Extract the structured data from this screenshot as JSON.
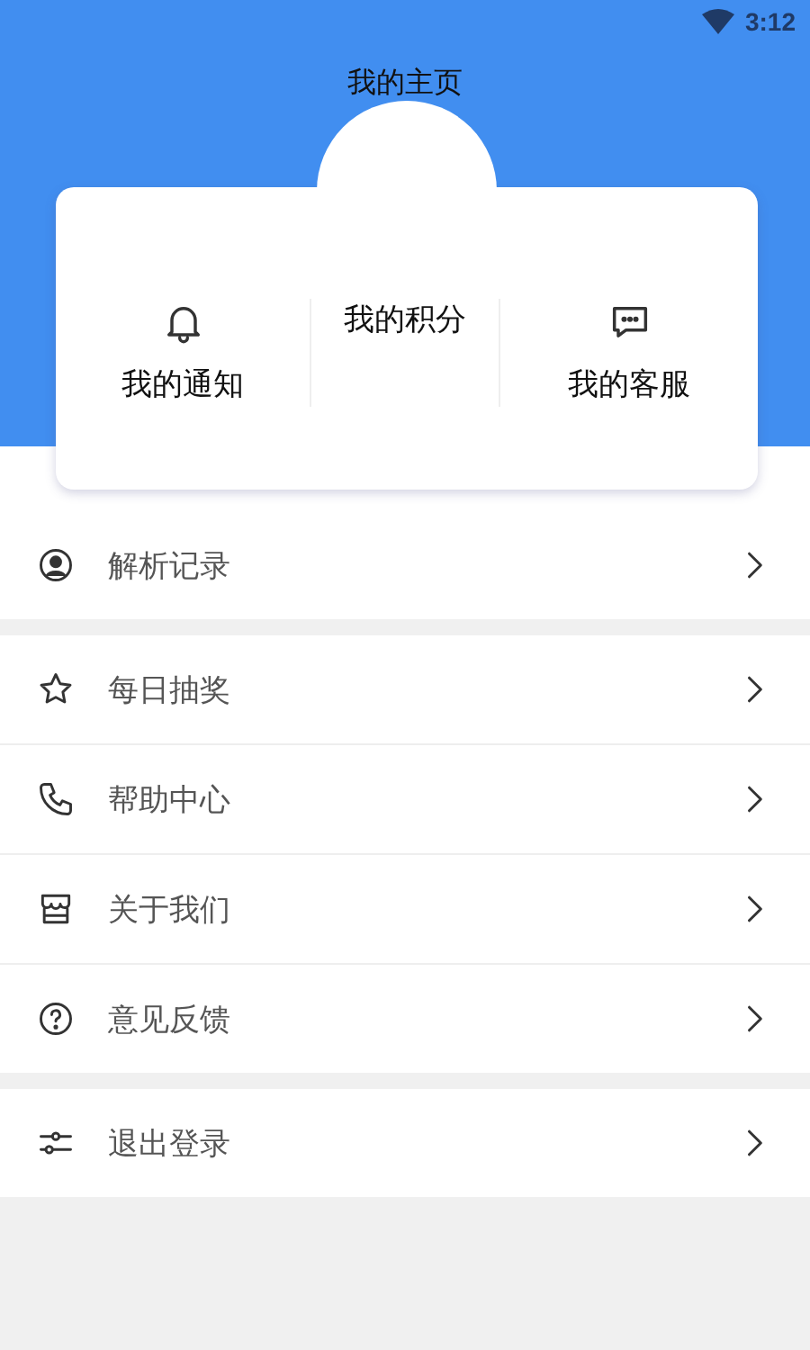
{
  "status_bar": {
    "time": "3:12"
  },
  "title": "我的主页",
  "card": {
    "items": [
      {
        "label": "我的通知"
      },
      {
        "label": "我的积分"
      },
      {
        "label": "我的客服"
      }
    ]
  },
  "menu_groups": [
    [
      {
        "label": "解析记录"
      }
    ],
    [
      {
        "label": "每日抽奖"
      },
      {
        "label": "帮助中心"
      },
      {
        "label": "关于我们"
      },
      {
        "label": "意见反馈"
      }
    ],
    [
      {
        "label": "退出登录"
      }
    ]
  ]
}
